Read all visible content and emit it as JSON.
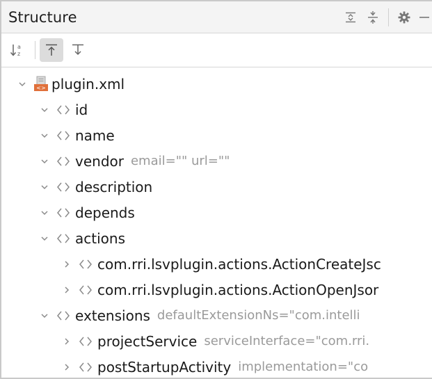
{
  "panel": {
    "title": "Structure"
  },
  "header_actions": [
    "expand-all-icon",
    "collapse-all-icon",
    "gear-icon",
    "minimize-icon"
  ],
  "toolbar": {
    "buttons": [
      "sort-alphabetically-icon",
      "navigate-with-single-click-icon",
      "always-select-opened-element-icon"
    ]
  },
  "tree": {
    "root": {
      "label": "plugin.xml",
      "expanded": true
    },
    "items": [
      {
        "label": "id",
        "attr": "",
        "expanded": true
      },
      {
        "label": "name",
        "attr": "",
        "expanded": true
      },
      {
        "label": "vendor",
        "attr": "email=\"\" url=\"\"",
        "expanded": true
      },
      {
        "label": "description",
        "attr": "",
        "expanded": true
      },
      {
        "label": "depends",
        "attr": "",
        "expanded": true
      },
      {
        "label": "actions",
        "attr": "",
        "expanded": true
      },
      {
        "label": "com.rri.lsvplugin.actions.ActionCreateJsc",
        "attr": "",
        "expanded": false
      },
      {
        "label": "com.rri.lsvplugin.actions.ActionOpenJsor",
        "attr": "",
        "expanded": false
      },
      {
        "label": "extensions",
        "attr": "defaultExtensionNs=\"com.intelli",
        "expanded": true
      },
      {
        "label": "projectService",
        "attr": "serviceInterface=\"com.rri.",
        "expanded": false
      },
      {
        "label": "postStartupActivity",
        "attr": "implementation=\"co",
        "expanded": false
      }
    ]
  },
  "colors": {
    "header_bg": "#f4f4f4",
    "active_button_bg": "#dcdcdc",
    "text": "#1a1a1a",
    "attr_text": "#9a9a9a",
    "icon": "#7a7a7a",
    "xml_icon_orange": "#e0703a"
  }
}
